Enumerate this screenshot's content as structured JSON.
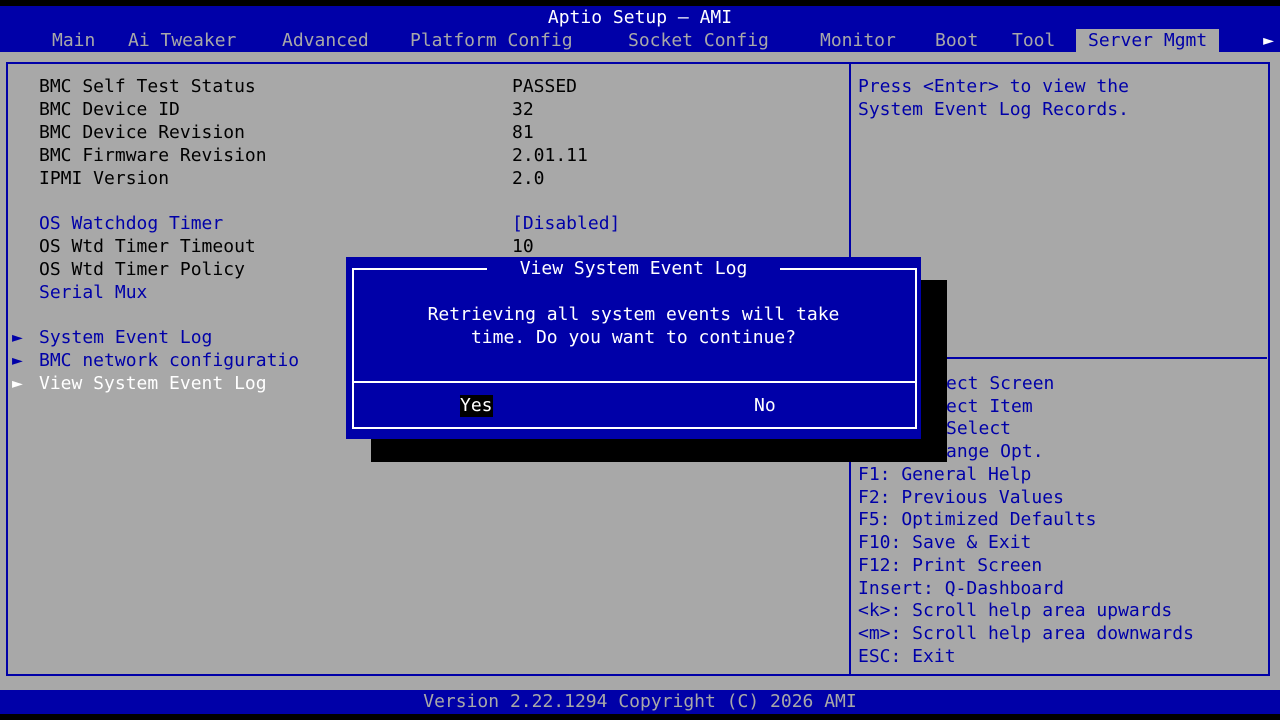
{
  "header": {
    "title": "Aptio Setup – AMI",
    "tabs": [
      "Main",
      "Ai Tweaker",
      "Advanced",
      "Platform Config",
      "Socket Config",
      "Monitor",
      "Boot",
      "Tool",
      "Server Mgmt"
    ],
    "active_tab": "Server Mgmt",
    "more_arrow": "►"
  },
  "settings": {
    "bmc_self_test": {
      "label": "BMC Self Test Status",
      "value": "PASSED"
    },
    "bmc_device_id": {
      "label": "BMC Device ID",
      "value": "32"
    },
    "bmc_device_rev": {
      "label": "BMC Device Revision",
      "value": "81"
    },
    "bmc_fw_rev": {
      "label": "BMC Firmware Revision",
      "value": "2.01.11"
    },
    "ipmi_version": {
      "label": "IPMI Version",
      "value": "2.0"
    },
    "os_watchdog": {
      "label": "OS Watchdog Timer",
      "value": "[Disabled]"
    },
    "os_wtd_timeout": {
      "label": "OS Wtd Timer Timeout",
      "value": "10"
    },
    "os_wtd_policy": {
      "label": "OS Wtd Timer Policy"
    },
    "serial_mux": {
      "label": "Serial Mux"
    },
    "submenus": {
      "system_event_log": "System Event Log",
      "bmc_network": "BMC network configuratio",
      "view_sel": "View System Event Log"
    },
    "submenu_marker": "►"
  },
  "help": {
    "description_line1": "Press <Enter> to view the",
    "description_line2": "System Event Log Records.",
    "keys": [
      "ect Screen",
      "ect Item",
      "Select",
      "ange Opt.",
      "F1: General Help",
      "F2: Previous Values",
      "F5: Optimized Defaults",
      "F10: Save & Exit",
      "F12: Print Screen",
      "Insert: Q-Dashboard",
      "<k>: Scroll help area upwards",
      "<m>: Scroll help area downwards",
      "ESC: Exit"
    ]
  },
  "dialog": {
    "title": " View System Event Log ",
    "message": "Retrieving all system events will take\ntime. Do you want to continue?",
    "yes_label": "Yes",
    "no_label": "No"
  },
  "footer": {
    "version": "Version 2.22.1294 Copyright (C) 2026 AMI"
  },
  "colors": {
    "bios_blue": "#0000a8",
    "bios_gray": "#a8a8a8",
    "white": "#ffffff",
    "black": "#000000"
  }
}
